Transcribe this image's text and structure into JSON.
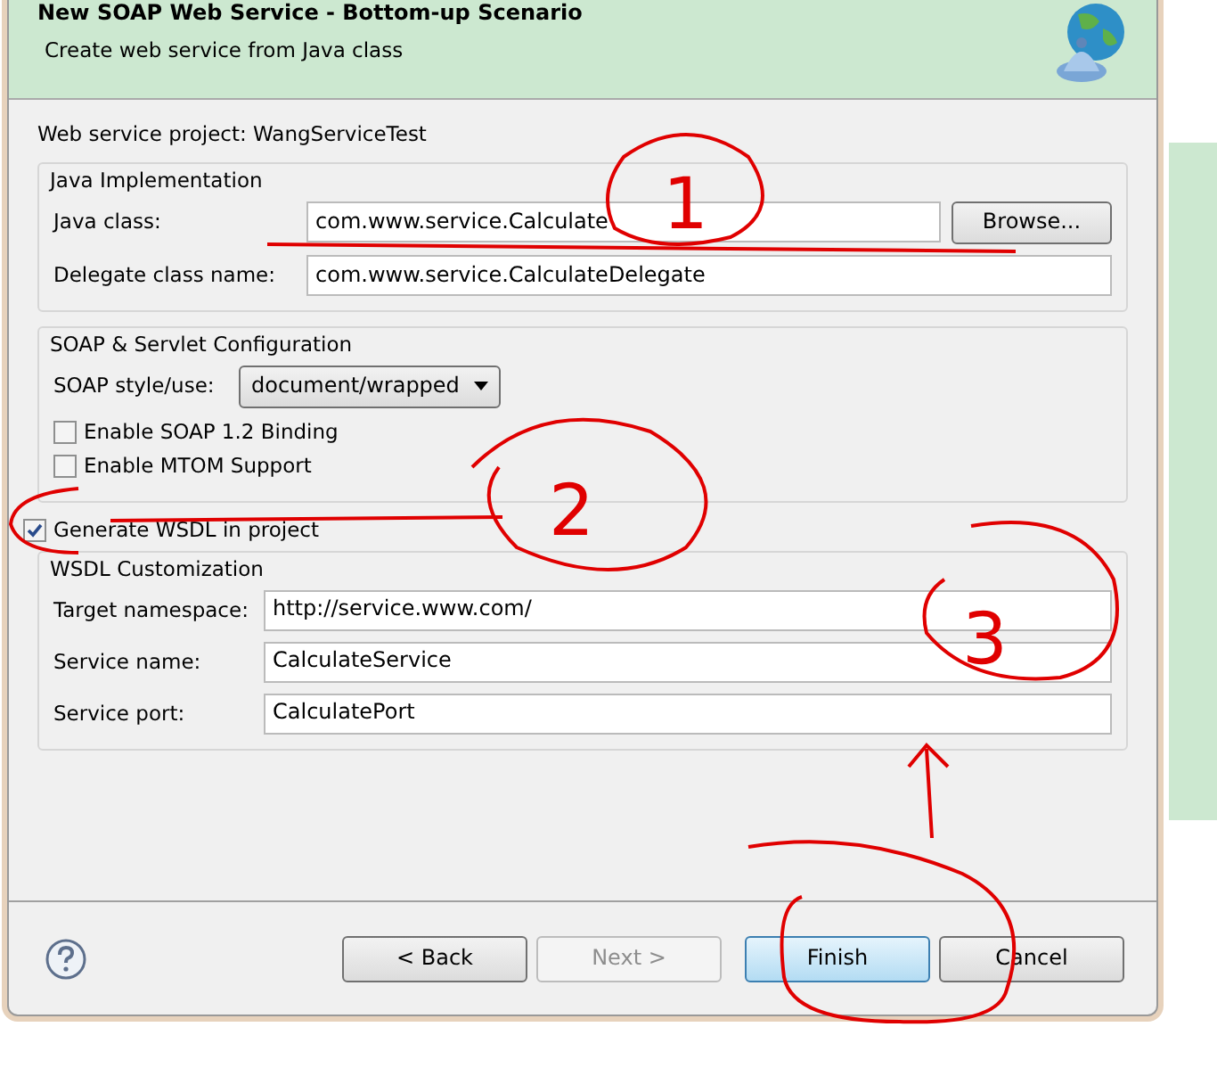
{
  "window": {
    "title": "New SOAP Web Service - Bottom-up Scenario",
    "subtitle": "Create web service from Java class"
  },
  "project": {
    "label": "Web service project:",
    "value": "WangServiceTest"
  },
  "java_implementation": {
    "title": "Java Implementation",
    "fields": [
      {
        "label": "Java class:",
        "value": "com.www.service.Calculate",
        "button": "Browse..."
      },
      {
        "label": "Delegate class name:",
        "value": "com.www.service.CalculateDelegate"
      }
    ]
  },
  "soap_config": {
    "title": "SOAP & Servlet Configuration",
    "style_label": "SOAP style/use:",
    "style_value": "document/wrapped",
    "options": [
      {
        "label": "Enable SOAP 1.2 Binding",
        "checked": false
      },
      {
        "label": "Enable MTOM Support",
        "checked": false
      }
    ]
  },
  "generate_wsdl": {
    "label": "Generate WSDL in project",
    "checked": true
  },
  "wsdl_customization": {
    "title": "WSDL Customization",
    "fields": [
      {
        "label": "Target namespace:",
        "value": "http://service.www.com/"
      },
      {
        "label": "Service name:",
        "value": "CalculateService"
      },
      {
        "label": "Service port:",
        "value": "CalculatePort"
      }
    ]
  },
  "buttons": [
    {
      "label": "< Back",
      "disabled": false,
      "default": false
    },
    {
      "label": "Next >",
      "disabled": true,
      "default": false
    },
    {
      "label": "Finish",
      "disabled": false,
      "default": true
    },
    {
      "label": "Cancel",
      "disabled": false,
      "default": false
    }
  ],
  "annotations": [
    {
      "label": "1"
    },
    {
      "label": "2"
    },
    {
      "label": "3"
    }
  ]
}
